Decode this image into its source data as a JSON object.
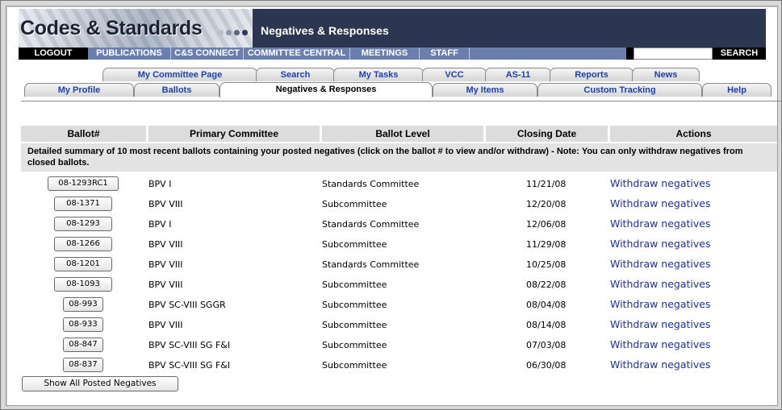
{
  "header": {
    "logo": "Codes & Standards",
    "page_title": "Negatives & Responses",
    "dot_colors": [
      "#d8dce4",
      "#b8bfcc",
      "#8e98ab",
      "#5b6681",
      "#2f3850"
    ]
  },
  "navbar": {
    "logout": "LOGOUT",
    "items": [
      "PUBLICATIONS",
      "C&S CONNECT",
      "COMMITTEE CENTRAL",
      "MEETINGS",
      "STAFF"
    ],
    "search_label": "SEARCH",
    "search_value": ""
  },
  "tabs_top": [
    "My Committee Page",
    "Search",
    "My Tasks",
    "VCC",
    "AS-11",
    "Reports",
    "News"
  ],
  "tabs_bottom": [
    "My Profile",
    "Ballots",
    "Negatives & Responses",
    "My Items",
    "Custom Tracking",
    "Help"
  ],
  "table": {
    "headers": [
      "Ballot#",
      "Primary Committee",
      "Ballot Level",
      "Closing Date",
      "Actions"
    ],
    "summary": "Detailed summary of 10 most recent ballots containing your posted negatives (click on the ballot # to view and/or withdraw) - Note: You can only withdraw negatives from closed ballots.",
    "rows": [
      {
        "ballot": "08-1293RC1",
        "committee": "BPV I",
        "level": "Standards Committee",
        "date": "11/21/08",
        "action": "Withdraw negatives"
      },
      {
        "ballot": "08-1371",
        "committee": "BPV VIII",
        "level": "Subcommittee",
        "date": "12/20/08",
        "action": "Withdraw negatives"
      },
      {
        "ballot": "08-1293",
        "committee": "BPV I",
        "level": "Standards Committee",
        "date": "12/06/08",
        "action": "Withdraw negatives"
      },
      {
        "ballot": "08-1266",
        "committee": "BPV VIII",
        "level": "Subcommittee",
        "date": "11/29/08",
        "action": "Withdraw negatives"
      },
      {
        "ballot": "08-1201",
        "committee": "BPV VIII",
        "level": "Standards Committee",
        "date": "10/25/08",
        "action": "Withdraw negatives"
      },
      {
        "ballot": "08-1093",
        "committee": "BPV VIII",
        "level": "Subcommittee",
        "date": "08/22/08",
        "action": "Withdraw negatives"
      },
      {
        "ballot": "08-993",
        "committee": "BPV SC-VIII SGGR",
        "level": "Subcommittee",
        "date": "08/04/08",
        "action": "Withdraw negatives"
      },
      {
        "ballot": "08-933",
        "committee": "BPV VIII",
        "level": "Subcommittee",
        "date": "08/14/08",
        "action": "Withdraw negatives"
      },
      {
        "ballot": "08-847",
        "committee": "BPV SC-VIII SG F&I",
        "level": "Subcommittee",
        "date": "07/03/08",
        "action": "Withdraw negatives"
      },
      {
        "ballot": "08-837",
        "committee": "BPV SC-VIII SG F&I",
        "level": "Subcommittee",
        "date": "06/30/08",
        "action": "Withdraw negatives"
      }
    ]
  },
  "show_all_label": "Show All Posted Negatives"
}
